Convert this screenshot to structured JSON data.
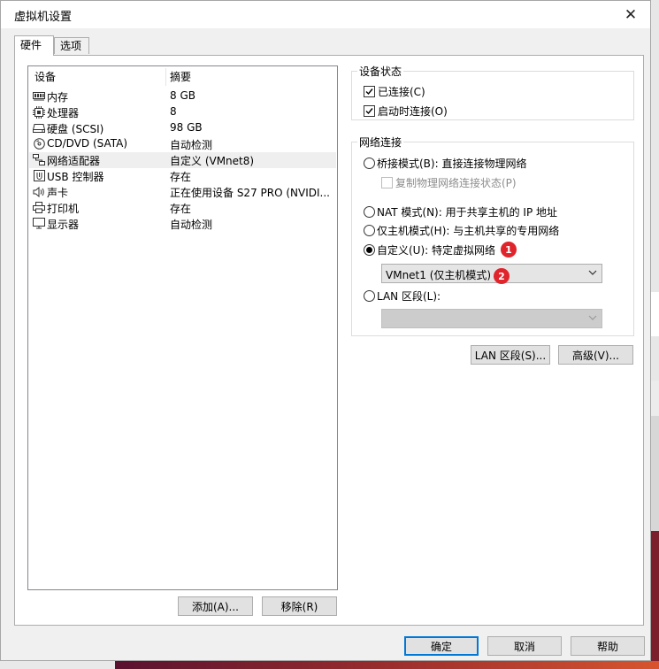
{
  "window": {
    "title": "虚拟机设置",
    "close": "✕"
  },
  "tabs": [
    {
      "label": "硬件",
      "active": true
    },
    {
      "label": "选项",
      "active": false
    }
  ],
  "device_list": {
    "headers": {
      "device": "设备",
      "summary": "摘要"
    },
    "rows": [
      {
        "icon": "memory-icon",
        "name": "内存",
        "summary": "8 GB"
      },
      {
        "icon": "processor-icon",
        "name": "处理器",
        "summary": "8"
      },
      {
        "icon": "hard-disk-icon",
        "name": "硬盘 (SCSI)",
        "summary": "98 GB"
      },
      {
        "icon": "cd-dvd-icon",
        "name": "CD/DVD (SATA)",
        "summary": "自动检测"
      },
      {
        "icon": "network-adapter-icon",
        "name": "网络适配器",
        "summary": "自定义 (VMnet8)",
        "selected": true
      },
      {
        "icon": "usb-icon",
        "name": "USB 控制器",
        "summary": "存在"
      },
      {
        "icon": "sound-icon",
        "name": "声卡",
        "summary": "正在使用设备 S27 PRO (NVIDI..."
      },
      {
        "icon": "printer-icon",
        "name": "打印机",
        "summary": "存在"
      },
      {
        "icon": "display-icon",
        "name": "显示器",
        "summary": "自动检测"
      }
    ]
  },
  "list_buttons": {
    "add": "添加(A)...",
    "remove": "移除(R)"
  },
  "device_status": {
    "title": "设备状态",
    "connected": {
      "label": "已连接(C)",
      "checked": true
    },
    "connect_on_power": {
      "label": "启动时连接(O)",
      "checked": true
    }
  },
  "network": {
    "title": "网络连接",
    "bridged": {
      "label": "桥接模式(B): 直接连接物理网络",
      "selected": false
    },
    "replicate": {
      "label": "复制物理网络连接状态(P)",
      "checked": false
    },
    "nat": {
      "label": "NAT 模式(N): 用于共享主机的 IP 地址",
      "selected": false
    },
    "host_only": {
      "label": "仅主机模式(H): 与主机共享的专用网络",
      "selected": false
    },
    "custom": {
      "label": "自定义(U): 特定虚拟网络",
      "selected": true
    },
    "custom_value": "VMnet1 (仅主机模式)",
    "lan_segment": {
      "label": "LAN 区段(L):",
      "selected": false
    },
    "lan_value": ""
  },
  "badges": {
    "one": "1",
    "two": "2"
  },
  "network_buttons": {
    "lan_segments": "LAN 区段(S)...",
    "advanced": "高级(V)..."
  },
  "footer": {
    "ok": "确定",
    "cancel": "取消",
    "help": "帮助"
  }
}
